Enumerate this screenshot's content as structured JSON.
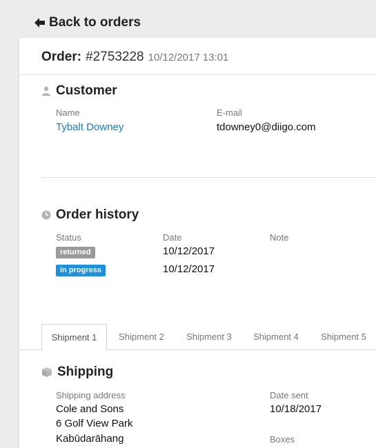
{
  "nav": {
    "back_label": "Back to orders"
  },
  "order": {
    "label": "Order:",
    "number": "#2753228",
    "datetime": "10/12/2017 13:01"
  },
  "customer": {
    "title": "Customer",
    "name_label": "Name",
    "name_value": "Tybalt Downey",
    "email_label": "E-mail",
    "email_value": "tdowney0@diigo.com"
  },
  "history": {
    "title": "Order history",
    "status_label": "Status",
    "date_label": "Date",
    "note_label": "Note",
    "rows": [
      {
        "status": "returned",
        "date": "10/12/2017"
      },
      {
        "status": "in progress",
        "date": "10/12/2017"
      }
    ]
  },
  "tabs": [
    "Shipment 1",
    "Shipment 2",
    "Shipment 3",
    "Shipment 4",
    "Shipment 5"
  ],
  "shipping": {
    "title": "Shipping",
    "address_label": "Shipping address",
    "address_lines": [
      "Cole and Sons",
      "6 Golf View Park",
      "Kabūdarāhang"
    ],
    "date_sent_label": "Date sent",
    "date_sent_value": "10/18/2017",
    "boxes_label": "Boxes"
  },
  "colors": {
    "link": "#1a7bc1",
    "badge_returned": "#9a9a9a",
    "badge_in_progress": "#1e90e0"
  },
  "icons": {
    "back": "arrow-left-icon",
    "customer": "user-icon",
    "history": "clock-icon",
    "shipping": "box-icon"
  }
}
